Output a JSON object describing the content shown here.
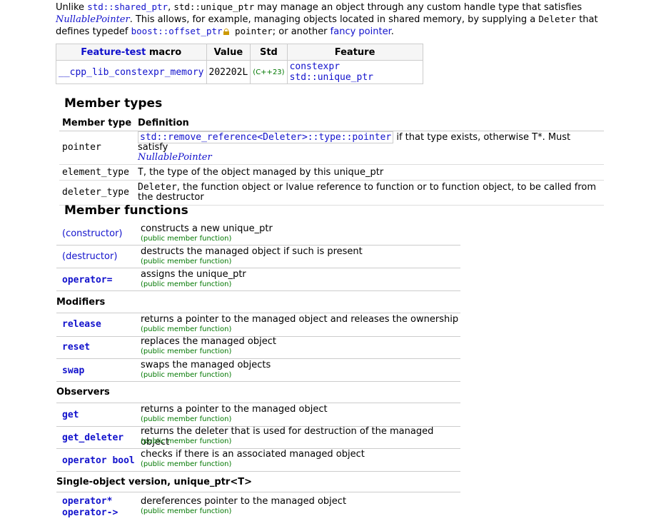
{
  "intro": {
    "t1": "Unlike ",
    "shared_ptr": "std::shared_ptr",
    "t2": ", ",
    "unique_ptr": "std::unique_ptr",
    "t3": " may manage an object through any custom handle type that satisfies",
    "nullable": "NullablePointer",
    "t4": ". This allows, for example, managing objects located in shared memory, by supplying a ",
    "deleter": "Deleter",
    "t5": " that",
    "t6": "defines typedef ",
    "offset_ptr": "boost::offset_ptr",
    "t7": " pointer",
    "t8": "; or another ",
    "fancy": "fancy pointer",
    "t9": "."
  },
  "ftm": {
    "headers": {
      "macro_link": "Feature-test",
      "macro_rest": " macro",
      "value": "Value",
      "std": "Std",
      "feature": "Feature"
    },
    "row": {
      "macro": "__cpp_lib_constexpr_memory",
      "value": "202202L",
      "std": "(C++23)",
      "feature_a": "constexpr",
      "feature_b": "std::unique_ptr"
    }
  },
  "member_types": {
    "heading": "Member types",
    "col1": "Member type",
    "col2": "Definition",
    "rows": [
      {
        "name": "pointer",
        "def_code": "std::remove_reference<Deleter>::type::pointer",
        "def_text": " if that type exists, otherwise T*. Must satisfy",
        "def_link": "NullablePointer"
      },
      {
        "name": "element_type",
        "def_code": "T",
        "def_text": ", the type of the object managed by this unique_ptr"
      },
      {
        "name": "deleter_type",
        "def_code": "Deleter",
        "def_text": ", the function object or lvalue reference to function or to function object, to be called from the destructor"
      }
    ]
  },
  "member_functions": {
    "heading": "Member functions",
    "kind": "(public member function)",
    "rows": [
      {
        "name": "(constructor)",
        "desc": "constructs a new unique_ptr"
      },
      {
        "name": "(destructor)",
        "desc": "destructs the managed object if such is present"
      },
      {
        "name": "operator=",
        "desc": "assigns the unique_ptr"
      },
      {
        "subhead": "Modifiers"
      },
      {
        "name": "release",
        "desc": "returns a pointer to the managed object and releases the ownership"
      },
      {
        "name": "reset",
        "desc": "replaces the managed object"
      },
      {
        "name": "swap",
        "desc": "swaps the managed objects"
      },
      {
        "subhead": "Observers"
      },
      {
        "name": "get",
        "desc": "returns a pointer to the managed object"
      },
      {
        "name": "get_deleter",
        "desc": "returns the deleter that is used for destruction of the managed object"
      },
      {
        "name": "operator bool",
        "desc": "checks if there is an associated managed object"
      },
      {
        "subhead": "Single-object version, unique_ptr<T>"
      },
      {
        "name": "operator*",
        "name2": "operator->",
        "desc": "dereferences pointer to the managed object"
      }
    ]
  }
}
